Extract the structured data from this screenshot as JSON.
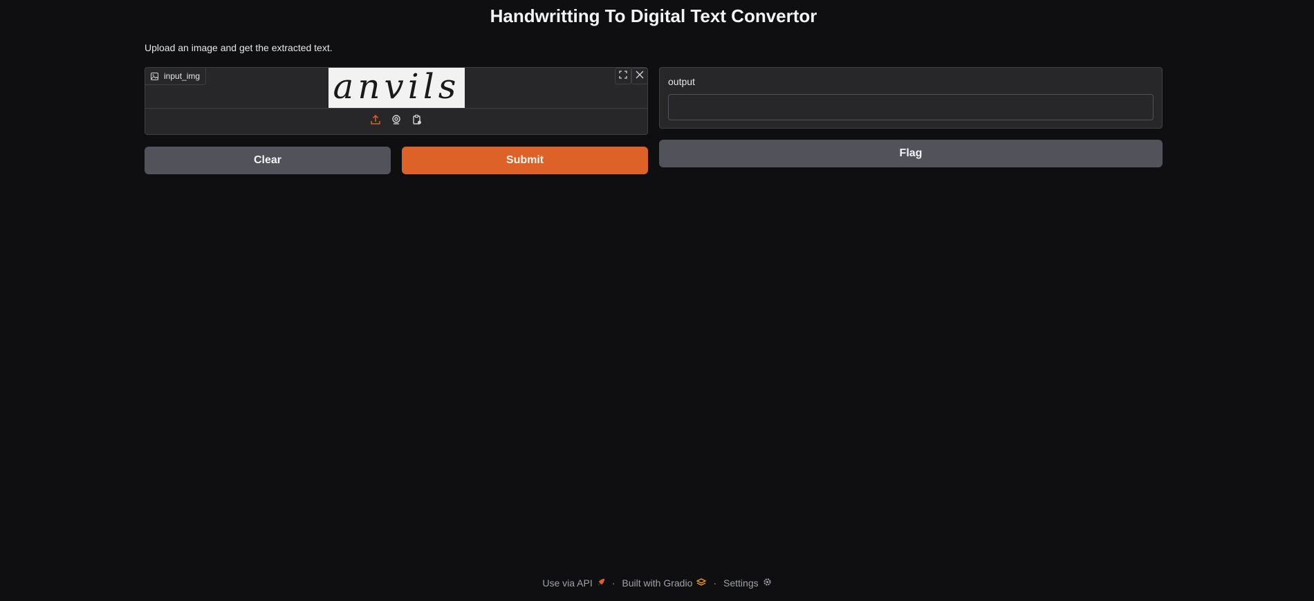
{
  "header": {
    "title": "Handwritting To Digital Text Convertor",
    "description": "Upload an image and get the extracted text."
  },
  "input_image": {
    "label": "input_img",
    "preview_text": "anvils",
    "sources": [
      "upload-icon",
      "webcam-icon",
      "clipboard-icon"
    ]
  },
  "output": {
    "label": "output",
    "value": ""
  },
  "buttons": {
    "clear": "Clear",
    "submit": "Submit",
    "flag": "Flag"
  },
  "footer": {
    "api": "Use via API",
    "built": "Built with Gradio",
    "settings": "Settings",
    "separator": "·"
  },
  "colors": {
    "background": "#0f0f11",
    "panel": "#27272a",
    "accent": "#dd6228",
    "secondary_button": "#52525b"
  }
}
